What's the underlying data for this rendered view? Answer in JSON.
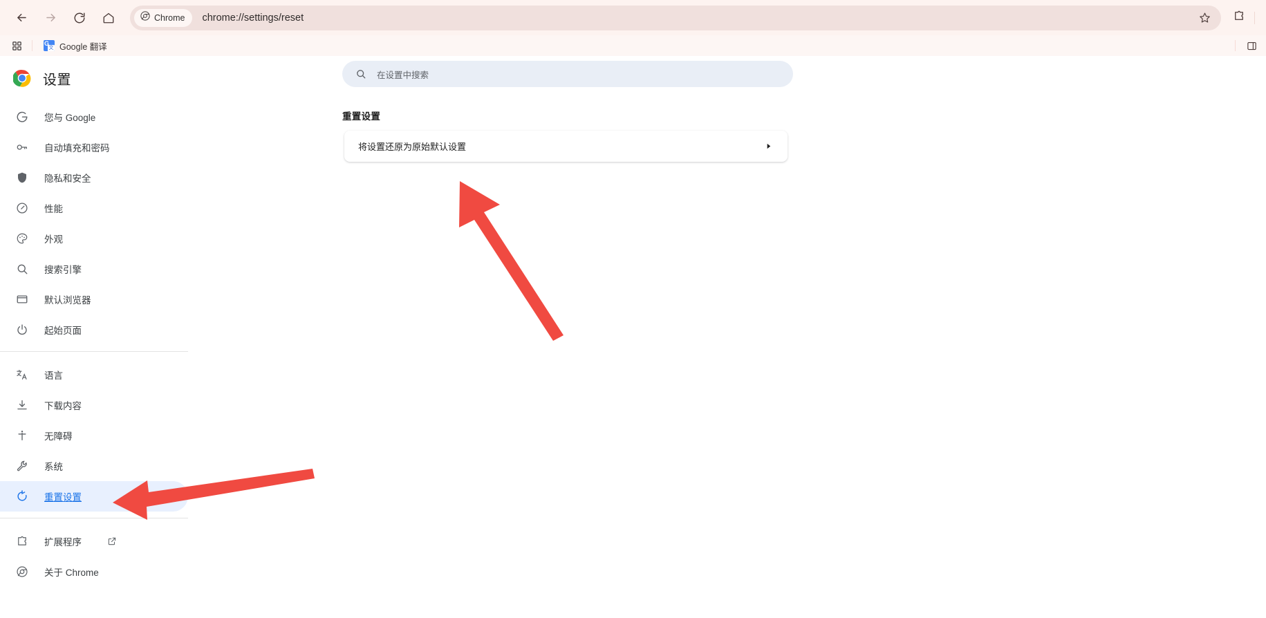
{
  "browser": {
    "nav": {
      "back_icon": "arrow-left-icon",
      "forward_icon": "arrow-right-icon",
      "reload_icon": "reload-icon",
      "home_icon": "home-icon"
    },
    "omnibox": {
      "chip_label": "Chrome",
      "chip_icon": "chrome-logo-icon",
      "url": "chrome://settings/reset",
      "star_icon": "bookmark-star-icon"
    },
    "toolbar": {
      "extensions_icon": "puzzle-piece-icon",
      "side_panel_icon": "side-panel-icon"
    },
    "bookmarks": {
      "apps_icon": "apps-grid-icon",
      "items": [
        {
          "label": "Google 翻译",
          "favicon": "google-translate-icon"
        }
      ],
      "right_icon": "bookmark-overflow-icon"
    }
  },
  "settings": {
    "header": {
      "logo_icon": "chrome-logo-icon",
      "title": "设置"
    },
    "sidebar": {
      "groups": [
        {
          "items": [
            {
              "label": "您与 Google",
              "icon": "google-g-icon",
              "selected": false
            },
            {
              "label": "自动填充和密码",
              "icon": "key-icon",
              "selected": false
            },
            {
              "label": "隐私和安全",
              "icon": "shield-icon",
              "selected": false
            },
            {
              "label": "性能",
              "icon": "speedometer-icon",
              "selected": false
            },
            {
              "label": "外观",
              "icon": "palette-icon",
              "selected": false
            },
            {
              "label": "搜索引擎",
              "icon": "search-icon",
              "selected": false
            },
            {
              "label": "默认浏览器",
              "icon": "browser-window-icon",
              "selected": false
            },
            {
              "label": "起始页面",
              "icon": "power-icon",
              "selected": false
            }
          ]
        },
        {
          "items": [
            {
              "label": "语言",
              "icon": "translate-icon",
              "selected": false
            },
            {
              "label": "下载内容",
              "icon": "download-icon",
              "selected": false
            },
            {
              "label": "无障碍",
              "icon": "accessibility-icon",
              "selected": false
            },
            {
              "label": "系统",
              "icon": "wrench-icon",
              "selected": false
            },
            {
              "label": "重置设置",
              "icon": "reset-circular-arrow-icon",
              "selected": true
            }
          ]
        },
        {
          "items": [
            {
              "label": "扩展程序",
              "icon": "puzzle-piece-icon",
              "selected": false,
              "external_icon": "open-in-new-icon"
            },
            {
              "label": "关于 Chrome",
              "icon": "chrome-outline-icon",
              "selected": false
            }
          ]
        }
      ]
    },
    "search": {
      "icon": "search-icon",
      "placeholder": "在设置中搜索",
      "value": ""
    },
    "main": {
      "section_title": "重置设置",
      "cards": [
        {
          "label": "将设置还原为原始默认设置",
          "chevron_icon": "chevron-right-icon"
        }
      ]
    }
  },
  "annotations": {
    "accent_color": "#f04a41",
    "arrows": [
      {
        "name": "arrow-to-reset-card",
        "points_to": "将设置还原为原始默认设置"
      },
      {
        "name": "arrow-to-sidebar-reset-item",
        "points_to": "重置设置"
      }
    ]
  },
  "colors": {
    "toolbar_bg": "#fdf3f0",
    "omnibox_bg": "#f0e0dd",
    "bookmarks_bg": "#fdf6f4",
    "page_bg": "#ffffff",
    "selected_nav_bg": "#e8f0fe",
    "selected_nav_fg": "#1a73e8",
    "search_bg": "#e9eef6",
    "annotation_red": "#f04a41"
  }
}
